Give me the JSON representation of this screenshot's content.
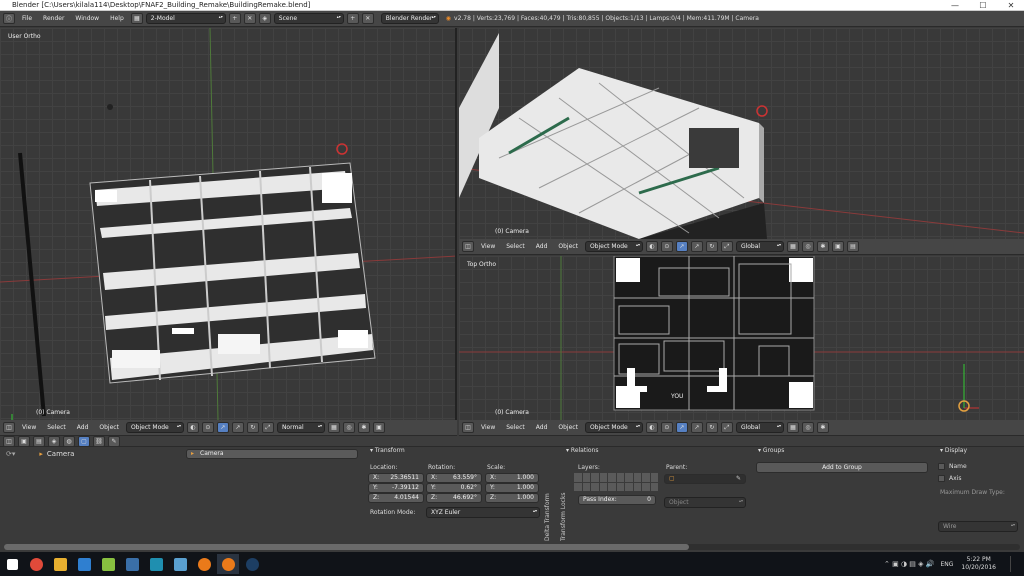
{
  "window": {
    "title": "Blender [C:\\Users\\kilala114\\Desktop\\FNAF2_Building_Remake\\BuildingRemake.blend]",
    "minimize": "—",
    "maximize": "☐",
    "close": "✕"
  },
  "info_header": {
    "menus": [
      "File",
      "Render",
      "Window",
      "Help"
    ],
    "screen_layout": "2-Model",
    "scene": "Scene",
    "render_engine": "Blender Render",
    "stats": "v2.78 | Verts:23,769 | Faces:40,479 | Tris:80,855 | Objects:1/13 | Lamps:0/4 | Mem:411.79M | Camera"
  },
  "viewport_left": {
    "label": "User Ortho",
    "object_label": "(0) Camera"
  },
  "viewport_top_right": {
    "object_label": "(0) Camera"
  },
  "viewport_bottom_right": {
    "label": "Top Ortho",
    "object_label": "(0) Camera",
    "sign_text": "YOU"
  },
  "view3d_header": {
    "menus": [
      "View",
      "Select",
      "Add",
      "Object"
    ],
    "mode": "Object Mode",
    "pivot_orientation_left": "Normal",
    "pivot_orientation_right": "Global"
  },
  "outliner": {
    "item": "Camera"
  },
  "properties": {
    "object_name": "Camera",
    "transform": {
      "title": "Transform",
      "location_label": "Location:",
      "rotation_label": "Rotation:",
      "scale_label": "Scale:",
      "location": [
        {
          "axis": "X:",
          "value": "25.36511"
        },
        {
          "axis": "Y:",
          "value": "-7.39112"
        },
        {
          "axis": "Z:",
          "value": "4.01544"
        }
      ],
      "rotation": [
        {
          "axis": "X:",
          "value": "63.559°"
        },
        {
          "axis": "Y:",
          "value": "0.62°"
        },
        {
          "axis": "Z:",
          "value": "46.692°"
        }
      ],
      "scale": [
        {
          "axis": "X:",
          "value": "1.000"
        },
        {
          "axis": "Y:",
          "value": "1.000"
        },
        {
          "axis": "Z:",
          "value": "1.000"
        }
      ],
      "rotation_mode_label": "Rotation Mode:",
      "rotation_mode": "XYZ Euler"
    },
    "side_tabs": [
      "Delta Transform",
      "Transform Locks"
    ],
    "relations": {
      "title": "Relations",
      "layers_label": "Layers:",
      "parent_label": "Parent:",
      "parent_type": "Object",
      "pass_index_label": "Pass Index:",
      "pass_index": "0"
    },
    "groups": {
      "title": "Groups",
      "add_button": "Add to Group"
    },
    "display": {
      "title": "Display",
      "name_label": "Name",
      "axis_label": "Axis",
      "max_draw_type_label": "Maximum Draw Type:",
      "max_draw_type": "Wire"
    }
  },
  "taskbar": {
    "time": "5:22 PM",
    "date": "10/20/2016",
    "lang": "ENG",
    "apps": [
      {
        "icon": "windows-start-icon",
        "color": "#ffffff"
      },
      {
        "icon": "chrome-icon",
        "color": "#e04a3a"
      },
      {
        "icon": "file-explorer-icon",
        "color": "#e8b030"
      },
      {
        "icon": "store-icon",
        "color": "#2f7fd0"
      },
      {
        "icon": "game-icon",
        "color": "#88c040"
      },
      {
        "icon": "app-icon",
        "color": "#3a6fa8"
      },
      {
        "icon": "app-icon-2",
        "color": "#1f8fb0"
      },
      {
        "icon": "photo-icon",
        "color": "#5aa0d0"
      },
      {
        "icon": "blender-icon",
        "color": "#ea7a1a"
      },
      {
        "icon": "blender-icon-2",
        "color": "#ea7a1a"
      },
      {
        "icon": "steam-icon",
        "color": "#1d3e63"
      }
    ]
  }
}
